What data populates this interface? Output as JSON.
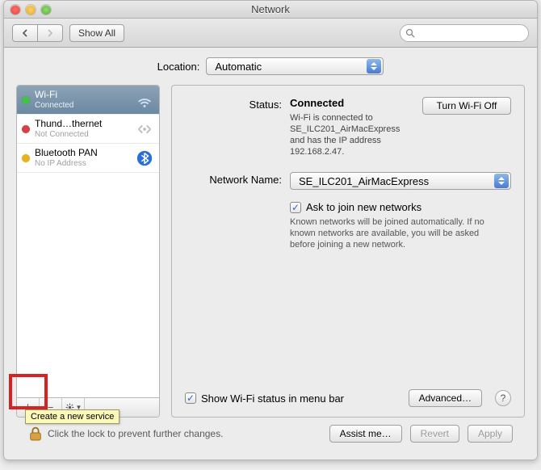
{
  "window": {
    "title": "Network"
  },
  "toolbar": {
    "showAll": "Show All"
  },
  "location": {
    "label": "Location:",
    "value": "Automatic"
  },
  "sidebar": {
    "items": [
      {
        "dotColor": "#45c245",
        "name": "Wi-Fi",
        "sub": "Connected",
        "iconName": "wifi-icon"
      },
      {
        "dotColor": "#d64242",
        "name": "Thund…thernet",
        "sub": "Not Connected",
        "iconName": "ethernet-icon"
      },
      {
        "dotColor": "#e8b21e",
        "name": "Bluetooth PAN",
        "sub": "No IP Address",
        "iconName": "bluetooth-icon"
      }
    ],
    "tooltip": "Create a new service"
  },
  "details": {
    "statusLabel": "Status:",
    "statusValue": "Connected",
    "turnOff": "Turn Wi-Fi Off",
    "statusDetail": "Wi-Fi is connected to SE_ILC201_AirMacExpress and has the IP address 192.168.2.47.",
    "networkNameLabel": "Network Name:",
    "networkNameValue": "SE_ILC201_AirMacExpress",
    "askJoin": "Ask to join new networks",
    "askJoinDetail": "Known networks will be joined automatically. If no known networks are available, you will be asked before joining a new network.",
    "showStatus": "Show Wi-Fi status in menu bar",
    "advanced": "Advanced…",
    "help": "?"
  },
  "footer": {
    "lockText": "Click the lock to prevent further changes.",
    "assist": "Assist me…",
    "revert": "Revert",
    "apply": "Apply"
  }
}
